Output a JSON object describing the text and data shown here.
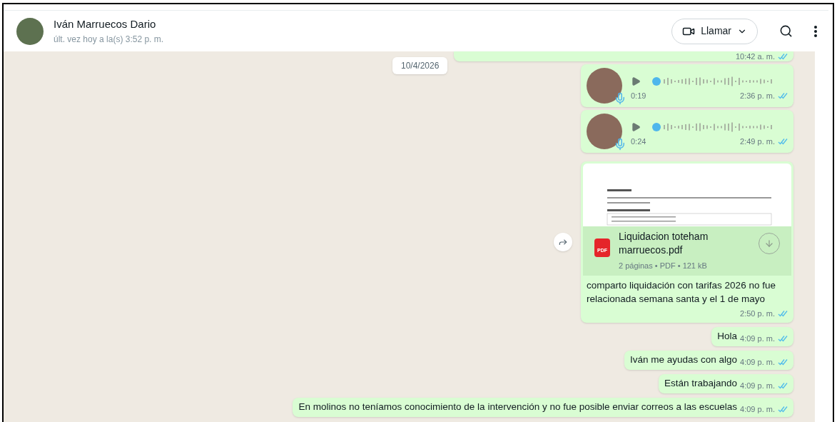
{
  "header": {
    "name": "Iván Marruecos Dario",
    "status": "últ. vez hoy a la(s) 3:52 p. m.",
    "call_button": "Llamar"
  },
  "date_chip": "10/4/2026",
  "messages": [
    {
      "kind": "partial",
      "time": "10:42 a. m.",
      "read": true
    },
    {
      "kind": "voice",
      "duration": "0:19",
      "time": "2:36 p. m.",
      "read": true
    },
    {
      "kind": "voice",
      "duration": "0:24",
      "time": "2:49 p. m.",
      "read": true
    },
    {
      "kind": "document",
      "file_badge": "PDF",
      "file_name": "Liquidacion toteham marruecos.pdf",
      "meta": "2 páginas • PDF • 121 kB",
      "caption": "comparto liquidación con tarifas 2026 no fue relacionada semana santa y el 1 de mayo",
      "time": "2:50 p. m.",
      "read": true
    },
    {
      "kind": "text",
      "text": "Hola",
      "time": "4:09 p. m.",
      "read": true
    },
    {
      "kind": "text",
      "text": "Iván me ayudas con algo",
      "time": "4:09 p. m.",
      "read": true
    },
    {
      "kind": "text",
      "text": "Están trabajando",
      "time": "4:09 p. m.",
      "read": true
    },
    {
      "kind": "text",
      "text": "En molinos no teníamos conocimiento de la intervención y no fue posible enviar correos a las escuelas",
      "time": "4:09 p. m.",
      "read": true
    }
  ]
}
